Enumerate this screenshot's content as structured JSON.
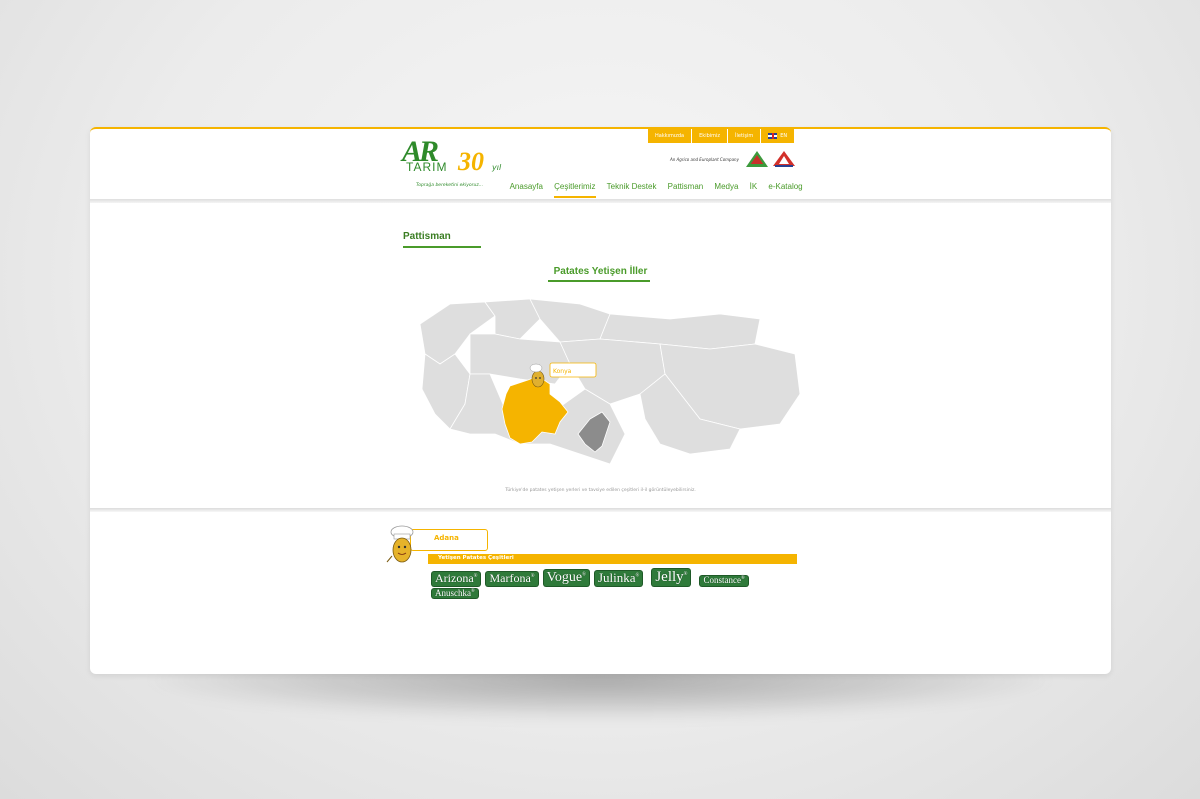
{
  "header": {
    "topbar": [
      "Hakkımızda",
      "Ekibimiz",
      "İletişim"
    ],
    "language": "EN",
    "company_note": "An Agrico and Europlant Company",
    "logo": {
      "brand": "AR",
      "name": "TARIM",
      "anniversary": "30",
      "anniversary_suffix": "yıl",
      "slogan": "Toprağa bereketini ekiyoruz..."
    },
    "nav": [
      "Anasayfa",
      "Çeşitlerimiz",
      "Teknik Destek",
      "Pattisman",
      "Medya",
      "İK",
      "e-Katalog"
    ],
    "active_nav": "Çeşitlerimiz"
  },
  "main": {
    "section_title": "Pattisman",
    "map_title": "Patates Yetişen İller",
    "map_callout": "Konya",
    "caption": "Türkiye'de patates yetişen yerleri ve tavsiye edilen çeşitleri il-il görüntüleyebilirsiniz."
  },
  "panel": {
    "city": "Adana",
    "varieties_label": "Yetişen Patates Çeşitleri",
    "varieties": [
      "Arizona",
      "Marfona",
      "Vogue",
      "Julinka",
      "Jelly",
      "Constance",
      "Anuschka"
    ]
  },
  "colors": {
    "accent": "#f5b400",
    "green": "#4a9b2a",
    "dark_green": "#2f7a3a",
    "map_gray": "#dedede",
    "map_highlight": "#f5b400",
    "map_dark": "#8c8c8c"
  }
}
